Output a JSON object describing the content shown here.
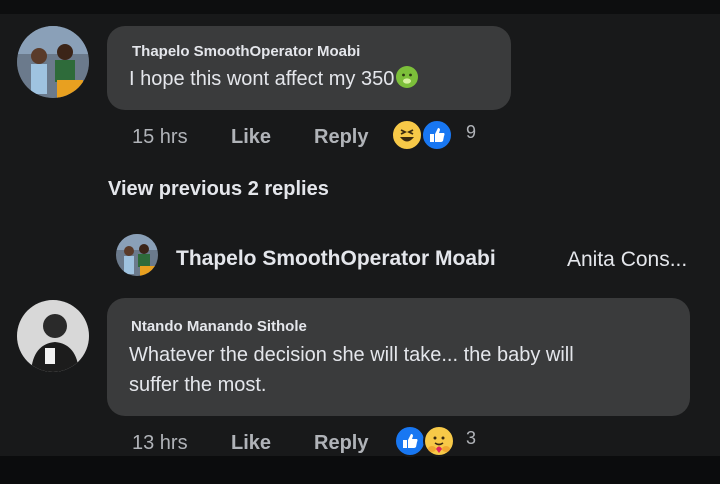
{
  "comments": [
    {
      "author": "Thapelo SmoothOperator Moabi",
      "text": "I hope this wont affect my 350",
      "time": "15 hrs",
      "like_label": "Like",
      "reply_label": "Reply",
      "reaction_count": "9",
      "reactions": [
        "laughing-face-icon",
        "like-thumb-icon"
      ],
      "inline_emoji": "nauseated-face-icon"
    },
    {
      "author": "Ntando Manando Sithole",
      "text_line1": "Whatever the decision she will take... the baby will",
      "text_line2": "suffer the most.",
      "time": "13 hrs",
      "like_label": "Like",
      "reply_label": "Reply",
      "reaction_count": "3",
      "reactions": [
        "like-thumb-icon",
        "care-hug-icon"
      ]
    }
  ],
  "view_previous": "View previous 2 replies",
  "reply_preview": {
    "author": "Thapelo SmoothOperator Moabi",
    "snippet": "Anita Cons..."
  },
  "colors": {
    "background": "#18191a",
    "bubble": "#3a3b3c",
    "text": "#e4e6eb",
    "meta": "#b0b3b8",
    "like_blue": "#1877f2",
    "haha_yellow": "#f7c948"
  }
}
